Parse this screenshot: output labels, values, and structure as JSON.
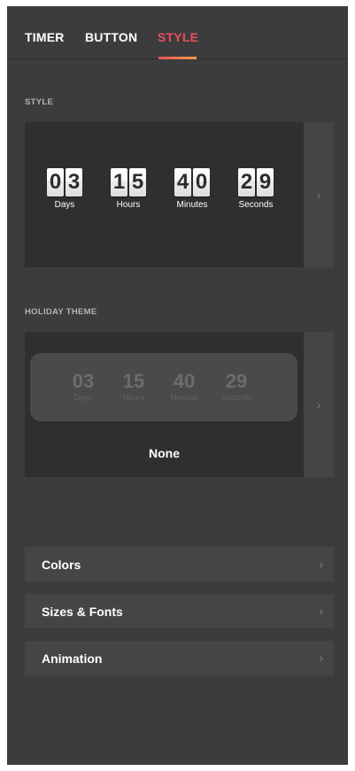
{
  "tabs": [
    {
      "label": "TIMER",
      "active": false
    },
    {
      "label": "BUTTON",
      "active": false
    },
    {
      "label": "STYLE",
      "active": true
    }
  ],
  "style_section": {
    "title": "STYLE",
    "preview": {
      "units": [
        {
          "d1": "0",
          "d2": "3",
          "label": "Days"
        },
        {
          "d1": "1",
          "d2": "5",
          "label": "Hours"
        },
        {
          "d1": "4",
          "d2": "0",
          "label": "Minutes"
        },
        {
          "d1": "2",
          "d2": "9",
          "label": "Seconds"
        }
      ]
    },
    "next_icon": "chevron-right-icon",
    "next_glyph": "›"
  },
  "holiday_section": {
    "title": "HOLIDAY THEME",
    "preview": {
      "units": [
        {
          "value": "03",
          "label": "Days"
        },
        {
          "value": "15",
          "label": "Hours"
        },
        {
          "value": "40",
          "label": "Minutes"
        },
        {
          "value": "29",
          "label": "Seconds"
        }
      ]
    },
    "selected_name": "None",
    "next_icon": "chevron-right-icon",
    "next_glyph": "›"
  },
  "menu": [
    {
      "label": "Colors",
      "chevron": "›"
    },
    {
      "label": "Sizes & Fonts",
      "chevron": "›"
    },
    {
      "label": "Animation",
      "chevron": "›"
    }
  ],
  "colors": {
    "panel_bg": "#3c3c3e",
    "accent": "#e8505b",
    "accent_gradient_end": "#f39c4a"
  }
}
